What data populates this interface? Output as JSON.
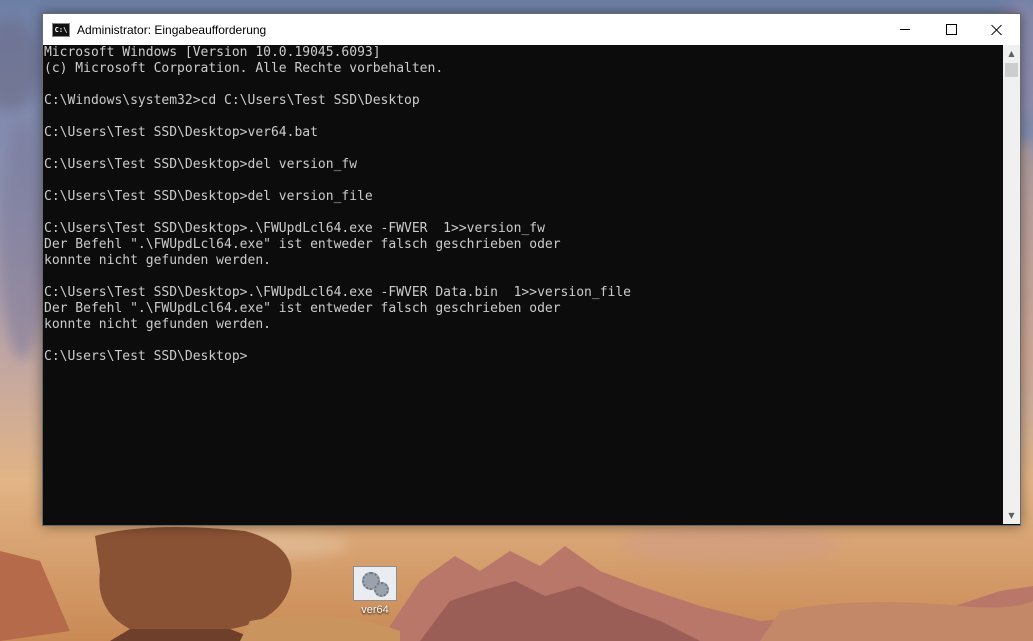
{
  "window": {
    "icon_text": "C:\\",
    "title": "Administrator: Eingabeaufforderung"
  },
  "console": {
    "lines": [
      "Microsoft Windows [Version 10.0.19045.6093]",
      "(c) Microsoft Corporation. Alle Rechte vorbehalten.",
      "",
      "C:\\Windows\\system32>cd C:\\Users\\Test SSD\\Desktop",
      "",
      "C:\\Users\\Test SSD\\Desktop>ver64.bat",
      "",
      "C:\\Users\\Test SSD\\Desktop>del version_fw",
      "",
      "C:\\Users\\Test SSD\\Desktop>del version_file",
      "",
      "C:\\Users\\Test SSD\\Desktop>.\\FWUpdLcl64.exe -FWVER  1>>version_fw",
      "Der Befehl \".\\FWUpdLcl64.exe\" ist entweder falsch geschrieben oder",
      "konnte nicht gefunden werden.",
      "",
      "C:\\Users\\Test SSD\\Desktop>.\\FWUpdLcl64.exe -FWVER Data.bin  1>>version_file",
      "Der Befehl \".\\FWUpdLcl64.exe\" ist entweder falsch geschrieben oder",
      "konnte nicht gefunden werden.",
      "",
      "C:\\Users\\Test SSD\\Desktop>"
    ]
  },
  "desktop": {
    "icon_label": "ver64"
  },
  "icons": {
    "minimize": "minimize-icon",
    "maximize": "maximize-icon",
    "close": "close-icon",
    "app": "cmd-icon",
    "shortcut": "batch-file-icon"
  }
}
